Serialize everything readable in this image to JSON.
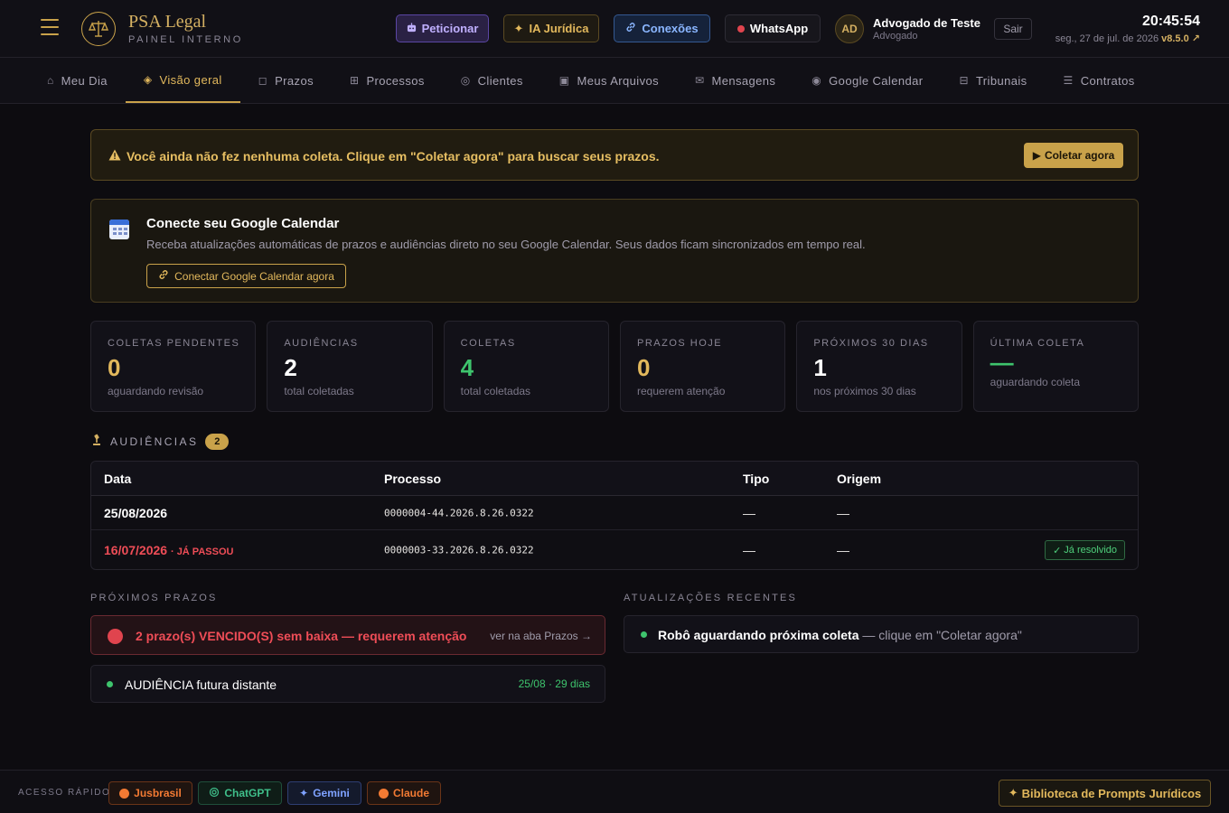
{
  "header": {
    "brand_name": "PSA Legal",
    "brand_sub": "PAINEL INTERNO",
    "buttons": {
      "peticionar": "Peticionar",
      "ia": "IA Jurídica",
      "conexoes": "Conexões",
      "whatsapp": "WhatsApp"
    },
    "user": {
      "initials": "AD",
      "name": "Advogado de Teste",
      "role": "Advogado"
    },
    "logout": "Sair",
    "clock": "20:45:54",
    "date": "seg., 27 de jul. de 2026",
    "version": "v8.5.0 ↗"
  },
  "nav": {
    "items": [
      {
        "label": "Meu Dia",
        "icon": "⌂"
      },
      {
        "label": "Visão geral",
        "icon": "◈"
      },
      {
        "label": "Prazos",
        "icon": "◻"
      },
      {
        "label": "Processos",
        "icon": "⊞"
      },
      {
        "label": "Clientes",
        "icon": "◎"
      },
      {
        "label": "Meus Arquivos",
        "icon": "▣"
      },
      {
        "label": "Mensagens",
        "icon": "✉"
      },
      {
        "label": "Google Calendar",
        "icon": "◉"
      },
      {
        "label": "Tribunais",
        "icon": "⊟"
      },
      {
        "label": "Contratos",
        "icon": "☰"
      }
    ],
    "active": "Visão geral"
  },
  "alert": {
    "text": "Você ainda não fez nenhuma coleta. Clique em \"Coletar agora\" para buscar seus prazos.",
    "button": "Coletar agora"
  },
  "gcal": {
    "title": "Conecte seu Google Calendar",
    "desc": "Receba atualizações automáticas de prazos e audiências direto no seu Google Calendar. Seus dados ficam sincronizados em tempo real.",
    "button": "Conectar Google Calendar agora"
  },
  "stats": [
    {
      "label": "COLETAS PENDENTES",
      "value": "0",
      "sub": "aguardando revisão"
    },
    {
      "label": "AUDIÊNCIAS",
      "value": "2",
      "sub": "total coletadas"
    },
    {
      "label": "COLETAS",
      "value": "4",
      "sub": "total coletadas"
    },
    {
      "label": "PRAZOS HOJE",
      "value": "0",
      "sub": "requerem atenção"
    },
    {
      "label": "PRÓXIMOS 30 DIAS",
      "value": "1",
      "sub": "nos próximos 30 dias"
    },
    {
      "label": "ÚLTIMA COLETA",
      "value": "—",
      "sub": "aguardando coleta"
    }
  ],
  "audiencias": {
    "title": "AUDIÊNCIAS",
    "count": "2",
    "columns": [
      "Data",
      "Processo",
      "Tipo",
      "Origem"
    ],
    "rows": [
      {
        "date": "25/08/2026",
        "note": "",
        "processo": "0000004-44.2026.8.26.0322",
        "tipo": "—",
        "origem": "—"
      },
      {
        "date": "16/07/2026",
        "note": "· JÁ PASSOU",
        "processo": "0000003-33.2026.8.26.0322",
        "tipo": "—",
        "origem": "—",
        "status": "Já resolvido"
      }
    ]
  },
  "prazos": {
    "title": "PRÓXIMOS PRAZOS",
    "vencidos_text": "2 prazo(s) VENCIDO(S) sem baixa — requerem atenção",
    "vencidos_link": "ver na aba Prazos →",
    "future_text": "AUDIÊNCIA futura distante",
    "future_date": "25/08 · 29 dias"
  },
  "atualizacoes": {
    "title": "ATUALIZAÇÕES RECENTES",
    "text_main": "Robô aguardando próxima coleta",
    "text_muted": "— clique em \"Coletar agora\""
  },
  "footer": {
    "label": "ACESSO RÁPIDO",
    "links": [
      "Jusbrasil",
      "ChatGPT",
      "Gemini",
      "Claude"
    ],
    "biblioteca": "Biblioteca de Prompts Jurídicos"
  },
  "colors": {
    "accent_gold": "#c9a24a",
    "danger": "#ef4d57",
    "success": "#3ec46d",
    "background": "#0d0c10"
  }
}
